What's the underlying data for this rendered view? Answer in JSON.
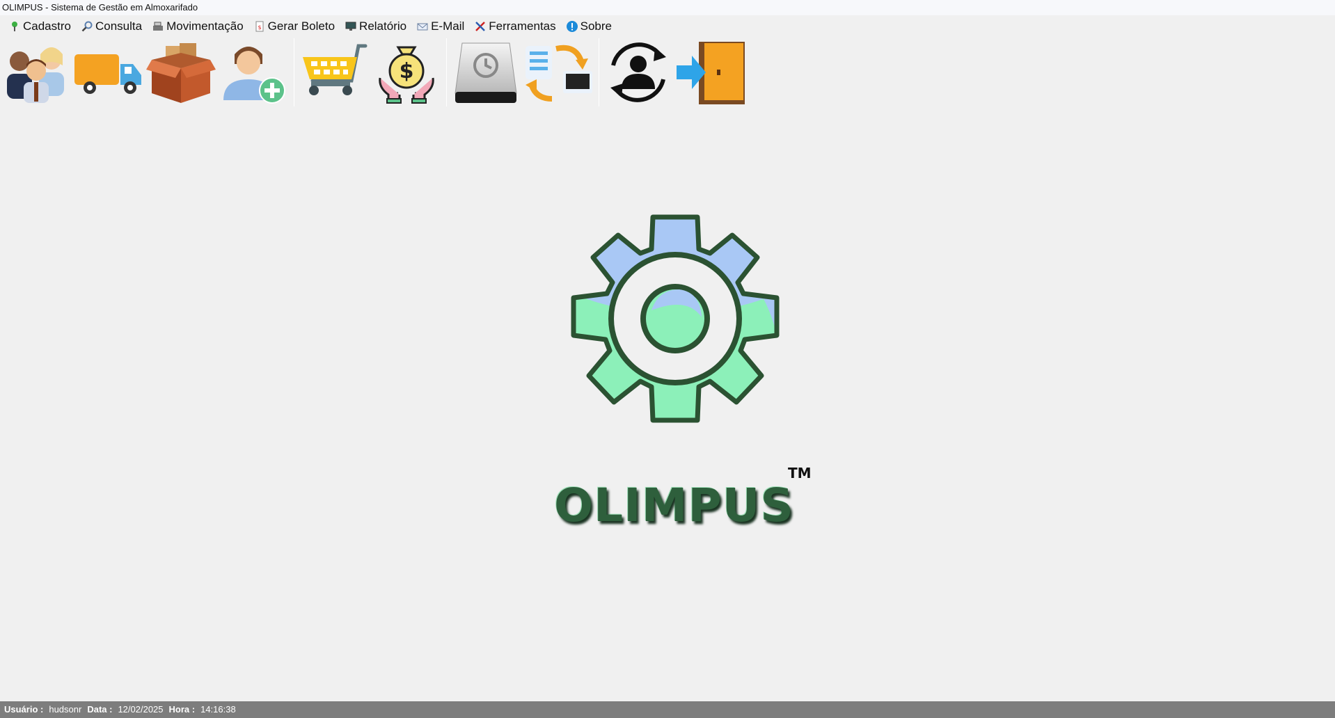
{
  "window": {
    "title": "OLIMPUS - Sistema de Gestão em Almoxarifado"
  },
  "menu": [
    {
      "label": "Cadastro",
      "icon": "pin-icon"
    },
    {
      "label": "Consulta",
      "icon": "magnifier-icon"
    },
    {
      "label": "Movimentação",
      "icon": "cash-register-icon"
    },
    {
      "label": "Gerar Boleto",
      "icon": "document-icon"
    },
    {
      "label": "Relatório",
      "icon": "monitor-icon"
    },
    {
      "label": "E-Mail",
      "icon": "envelope-icon"
    },
    {
      "label": "Ferramentas",
      "icon": "tools-icon"
    },
    {
      "label": "Sobre",
      "icon": "info-icon"
    }
  ],
  "toolbar": [
    "people-icon",
    "truck-icon",
    "boxes-icon",
    "add-user-icon",
    "shopping-cart-icon",
    "money-bag-icon",
    "backup-drive-icon",
    "sync-list-icon",
    "switch-user-icon",
    "exit-door-icon"
  ],
  "logo": {
    "text": "OLIMPUS",
    "trademark": "TM"
  },
  "status": {
    "user_label": "Usuário :",
    "user_value": "hudsonr",
    "date_label": "Data :",
    "date_value": "12/02/2025",
    "time_label": "Hora :",
    "time_value": "14:16:38"
  },
  "colors": {
    "gear_green": "#8cf0b9",
    "gear_blue": "#a9c8f5",
    "gear_outline": "#2b5232",
    "logo_text": "#2e5f3c",
    "statusbar": "#7d7d7d"
  }
}
